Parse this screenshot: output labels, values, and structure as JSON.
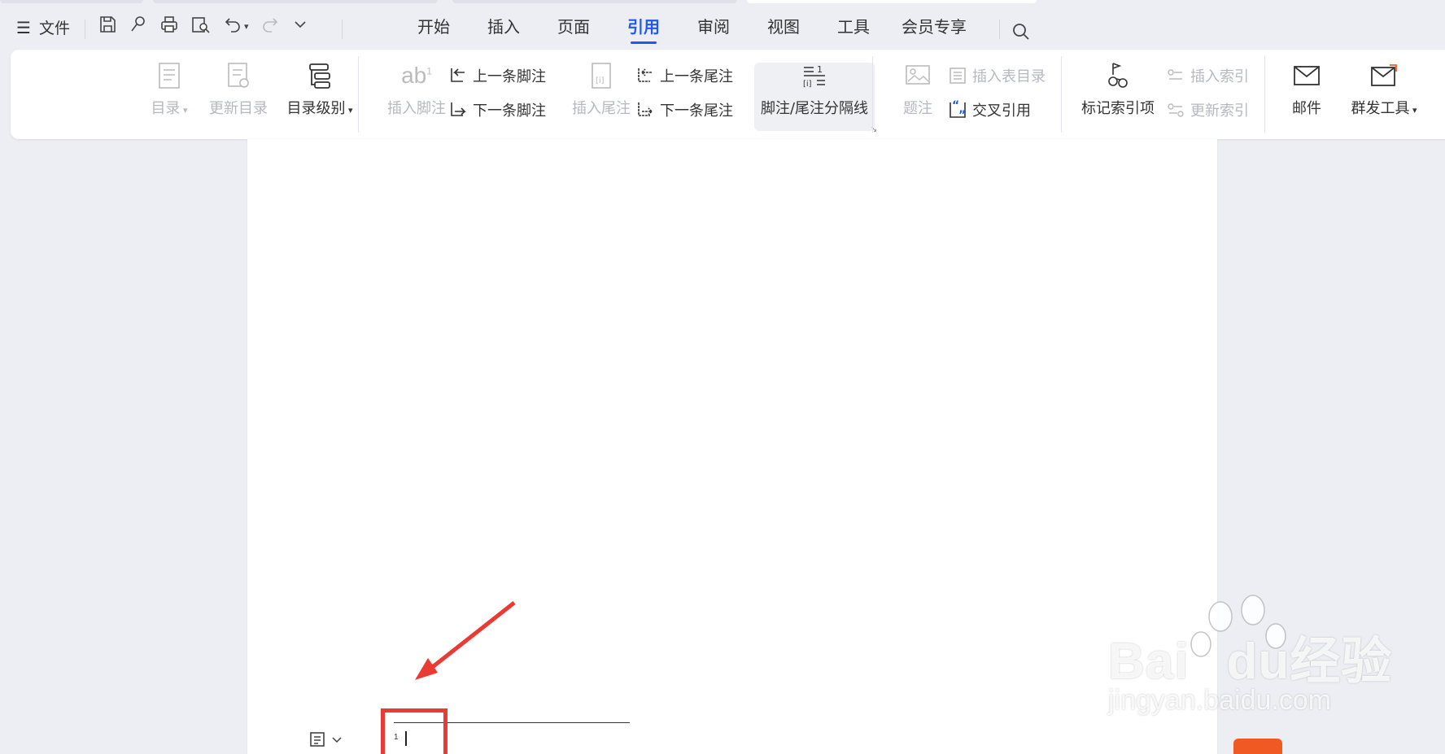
{
  "menubar": {
    "file_label": "文件",
    "tabs": [
      {
        "label": "开始",
        "active": false
      },
      {
        "label": "插入",
        "active": false
      },
      {
        "label": "页面",
        "active": false
      },
      {
        "label": "引用",
        "active": true
      },
      {
        "label": "审阅",
        "active": false
      },
      {
        "label": "视图",
        "active": false
      },
      {
        "label": "工具",
        "active": false
      },
      {
        "label": "会员专享",
        "active": false
      }
    ],
    "accent_color": "#2259e8"
  },
  "ribbon": {
    "toc": "目录",
    "update_toc": "更新目录",
    "toc_level": "目录级别",
    "insert_footnote": "插入脚注",
    "prev_footnote": "上一条脚注",
    "next_footnote": "下一条脚注",
    "insert_endnote": "插入尾注",
    "prev_endnote": "上一条尾注",
    "next_endnote": "下一条尾注",
    "separator_line": "脚注/尾注分隔线",
    "caption": "题注",
    "insert_table_of_figures": "插入表目录",
    "cross_reference": "交叉引用",
    "mark_index_entry": "标记索引项",
    "insert_index": "插入索引",
    "update_index": "更新索引",
    "mail": "邮件",
    "mass_send_tools": "群发工具"
  },
  "document": {
    "footnote_number": "1",
    "highlight_color": "#ea3a33"
  },
  "watermark": {
    "brand": "Bai",
    "brand_suffix": "du",
    "brand_cn": "经验",
    "url": "jingyan.baidu.com"
  }
}
